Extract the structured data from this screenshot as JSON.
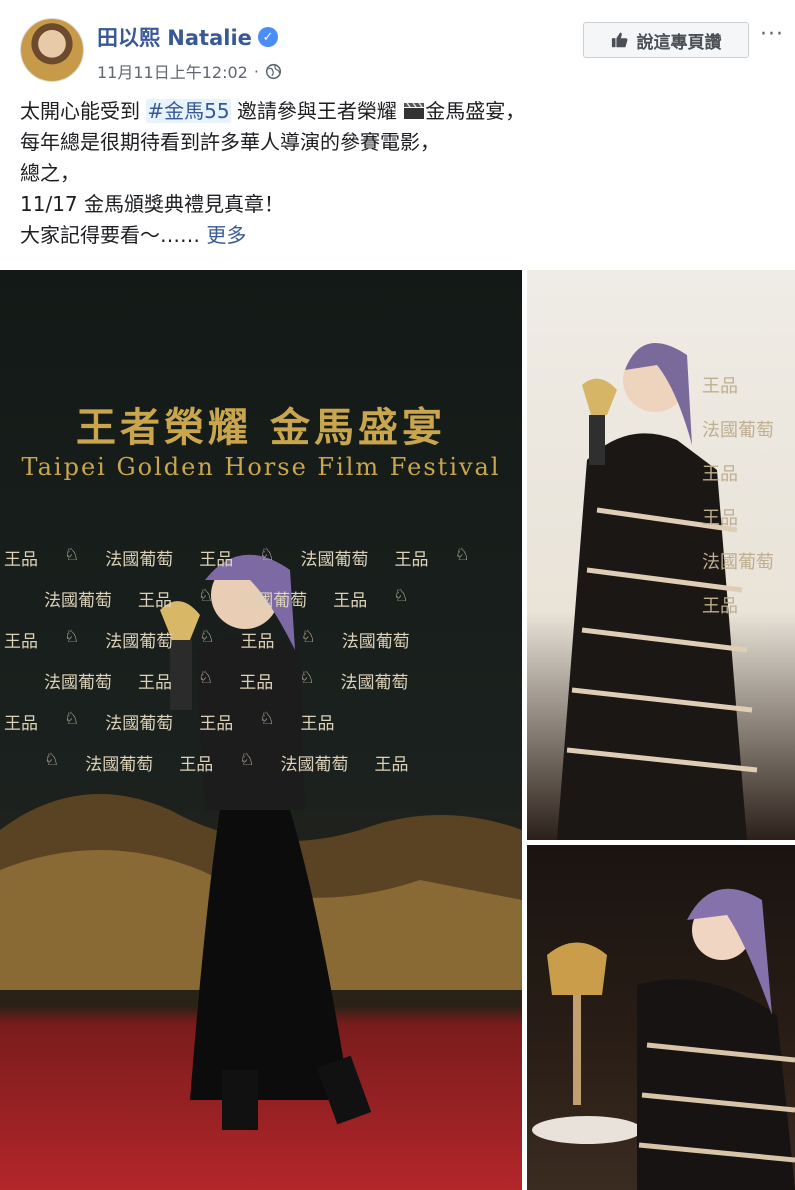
{
  "post": {
    "author": "田以熙 Natalie",
    "timestamp": "11月11日上午12:02",
    "separator": "·",
    "privacy_icon": "globe-icon",
    "verified_icon": "verified-badge-icon",
    "like_page_label": "說這專頁讚",
    "more_label": "···"
  },
  "body": {
    "line1_a": "太開心能受到 ",
    "line1_hashtag": "#金馬55",
    "line1_b": " 邀請參與王者榮耀 ",
    "line1_c": "金馬盛宴，",
    "line2": "每年總是很期待看到許多華人導演的參賽電影，",
    "line3": "總之，",
    "line4": "11/17 金馬頒獎典禮見真章！",
    "line5": "大家記得要看～…… ",
    "see_more": "更多"
  },
  "photos": {
    "backdrop_title_cn": "王者榮耀 金馬盛宴",
    "backdrop_title_en": "Taipei Golden Horse Film Festival",
    "sponsor_1": "王品",
    "sponsor_2": "法國葡萄"
  },
  "colors": {
    "link": "#385898",
    "text": "#1c1e21",
    "meta": "#606770",
    "gold": "#c9a64d",
    "carpet": "#b3262a"
  }
}
